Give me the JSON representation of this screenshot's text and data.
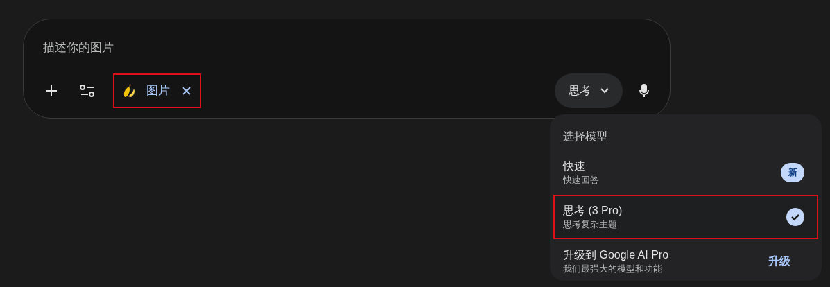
{
  "composer": {
    "placeholder": "描述你的图片",
    "chip": {
      "label": "图片",
      "highlighted": true
    },
    "mode_button": {
      "label": "思考"
    }
  },
  "menu": {
    "title": "选择模型",
    "items": [
      {
        "kind": "badge",
        "title": "快速",
        "subtitle": "快速回答",
        "badge": "新",
        "selected": false,
        "highlighted": false
      },
      {
        "kind": "option",
        "title": "思考 (3 Pro)",
        "subtitle": "思考复杂主题",
        "selected": true,
        "highlighted": true
      },
      {
        "kind": "action",
        "title": "升级到 Google AI Pro",
        "subtitle": "我们最强大的模型和功能",
        "action": "升级",
        "selected": false,
        "highlighted": false
      }
    ]
  }
}
